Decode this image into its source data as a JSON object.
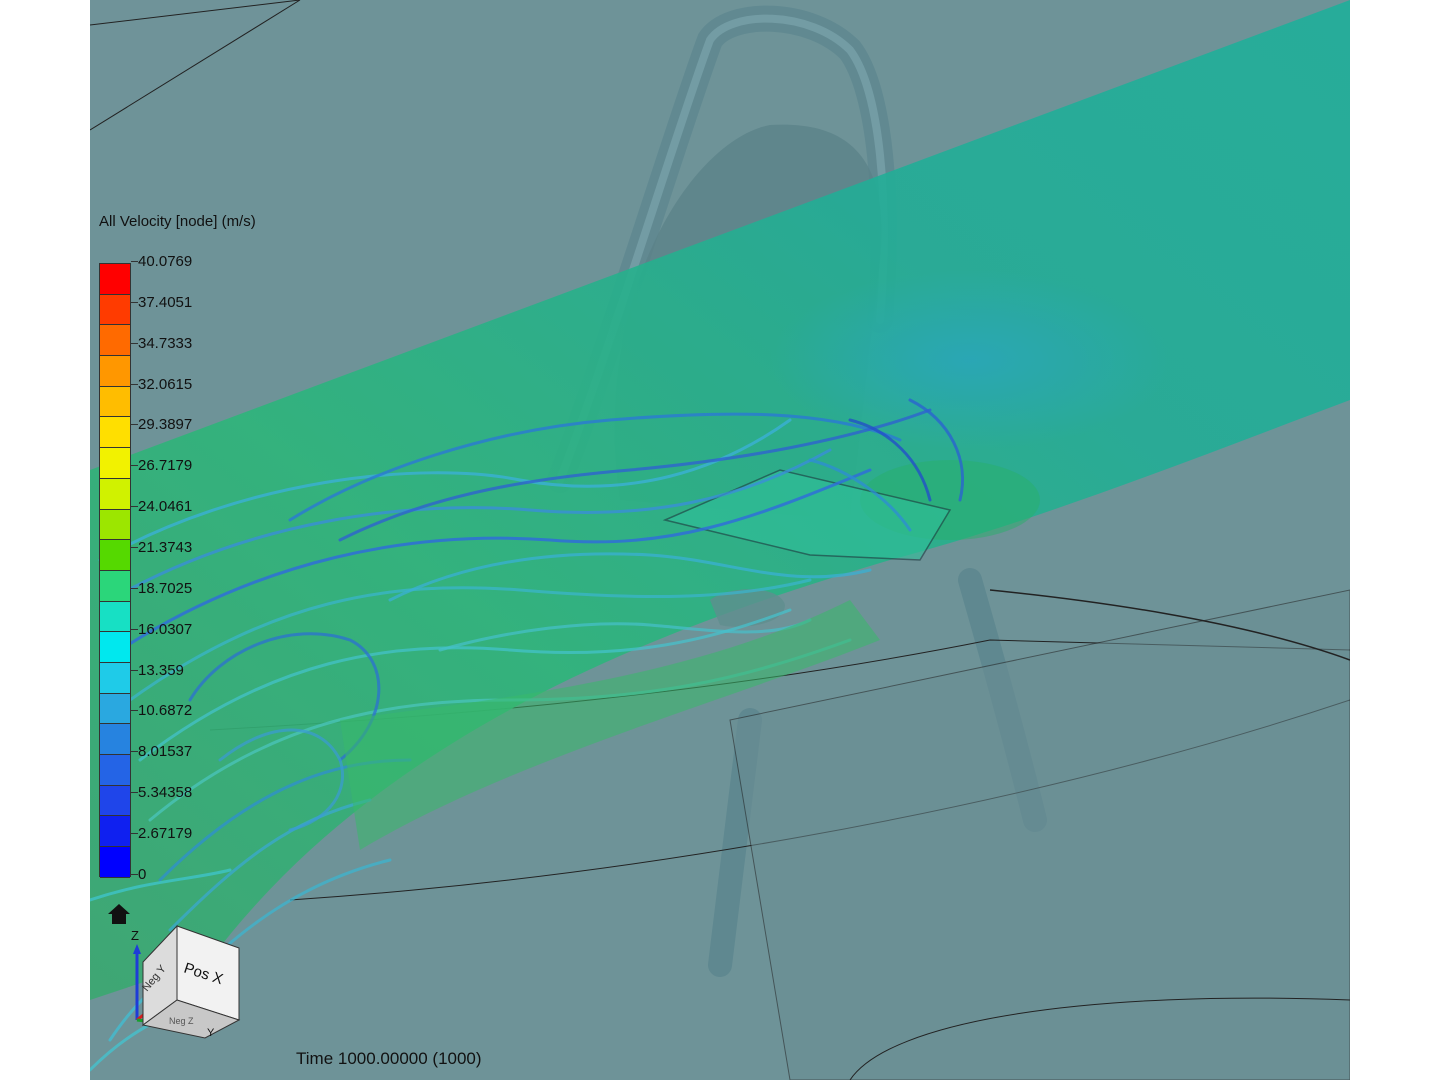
{
  "legend": {
    "title": "All Velocity [node] (m/s)",
    "values": [
      "40.0769",
      "37.4051",
      "34.7333",
      "32.0615",
      "29.3897",
      "26.7179",
      "24.0461",
      "21.3743",
      "18.7025",
      "16.0307",
      "13.359",
      "10.6872",
      "8.01537",
      "5.34358",
      "2.67179",
      "0"
    ],
    "colors": [
      "#ff0000",
      "#ff3b00",
      "#ff6a00",
      "#ff9700",
      "#ffbd00",
      "#ffdf00",
      "#f2f200",
      "#d0f200",
      "#9ce600",
      "#55d900",
      "#2bd67a",
      "#17e0c4",
      "#00e8ee",
      "#1fcbe8",
      "#2aa8e0",
      "#2683e0",
      "#2464e6",
      "#1f45ea",
      "#0f20f0",
      "#0000ff"
    ]
  },
  "status": {
    "time_label": "Time 1000.00000 (1000)"
  },
  "view_cube": {
    "front_label": "Pos X",
    "side_label": "Neg Y",
    "bottom_label": "Neg Z",
    "axis_z": "Z",
    "axis_y": "Y"
  },
  "icons": {
    "home": "home-icon"
  }
}
